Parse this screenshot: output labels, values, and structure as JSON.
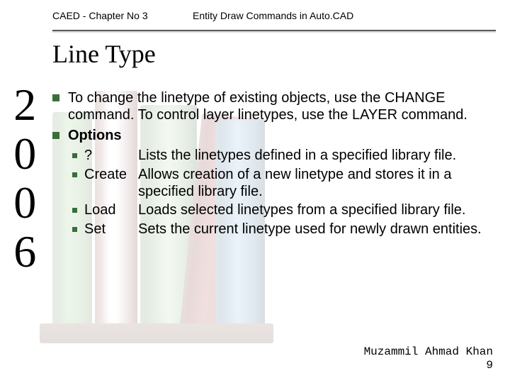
{
  "header": {
    "left": "CAED - Chapter No 3",
    "right": "Entity Draw Commands in Auto.CAD"
  },
  "title": "Line Type",
  "year": "2006",
  "body": {
    "para1": "To change the linetype of existing objects, use the CHANGE command. To control layer linetypes, use the LAYER command.",
    "options_label": "Options",
    "options": [
      {
        "term": "?",
        "desc": "Lists the linetypes defined in a specified library file."
      },
      {
        "term": "Create",
        "desc": "Allows creation of a new linetype and stores it in a specified library file."
      },
      {
        "term": "Load",
        "desc": "Loads selected linetypes from a specified library file."
      },
      {
        "term": "Set",
        "desc": "Sets the current linetype used for newly drawn entities."
      }
    ]
  },
  "footer": {
    "author": "Muzammil Ahmad Khan",
    "page": "9"
  }
}
